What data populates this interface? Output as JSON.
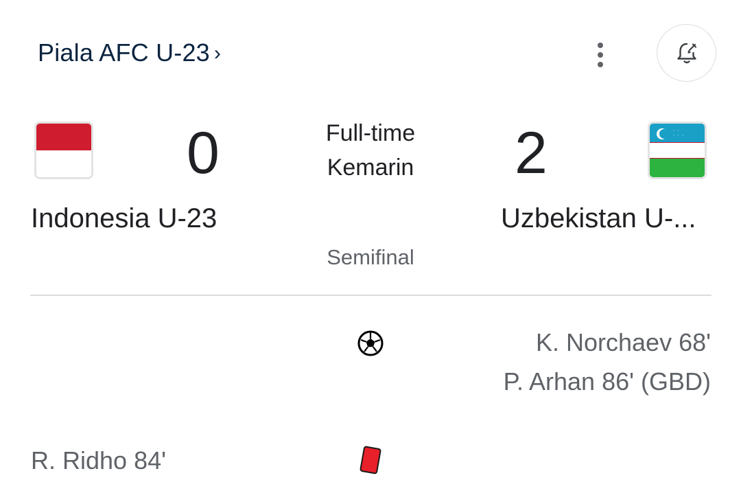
{
  "header": {
    "competition": "Piala AFC U-23",
    "chevron": "›",
    "more_icon": "more-vert-icon",
    "alert_icon": "bell-add-icon"
  },
  "match": {
    "status": "Full-time",
    "date": "Kemarin",
    "stage": "Semifinal",
    "home": {
      "name": "Indonesia U-23",
      "score": "0",
      "flag": "indonesia-flag",
      "flag_colors": [
        "#d01c2f",
        "#ffffff"
      ]
    },
    "away": {
      "name": "Uzbekistan U-...",
      "score": "2",
      "flag": "uzbekistan-flag",
      "flag_colors": [
        "#1aa0c6",
        "#ffffff",
        "#2db33f",
        "#c8102e"
      ]
    }
  },
  "events": {
    "goals": {
      "icon": "soccer-ball-icon",
      "home": [],
      "away": [
        "K. Norchaev 68'",
        "P. Arhan 86' (GBD)"
      ]
    },
    "red_cards": {
      "icon": "red-card-icon",
      "color": "#e8202a",
      "home": [
        "R. Ridho 84'"
      ],
      "away": []
    }
  }
}
